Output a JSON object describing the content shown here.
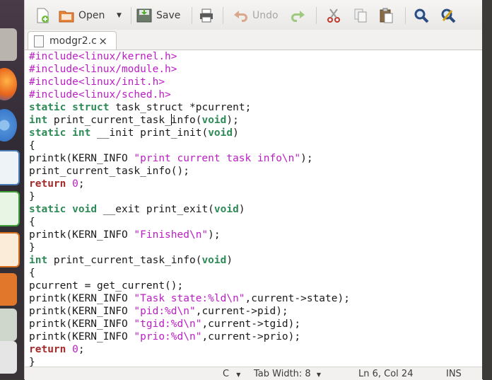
{
  "toolbar": {
    "open_label": "Open",
    "save_label": "Save",
    "undo_label": "Undo"
  },
  "tab": {
    "filename": "modgr2.c",
    "close": "×"
  },
  "code_lines": [
    "#include<linux/kernel.h>",
    "#include<linux/module.h>",
    "#include<linux/init.h>",
    "#include<linux/sched.h>",
    "static struct task_struct *pcurrent;",
    "int print_current_task_info(void);",
    "static int __init print_init(void)",
    "{",
    "printk(KERN_INFO \"print current task info\\n\");",
    "print_current_task_info();",
    "return 0;",
    "}",
    "static void __exit print_exit(void)",
    "{",
    "printk(KERN_INFO \"Finished\\n\");",
    "}",
    "int print_current_task_info(void)",
    "{",
    "pcurrent = get_current();",
    "printk(KERN_INFO \"Task state:%ld\\n\",current->state);",
    "printk(KERN_INFO \"pid:%d\\n\",current->pid);",
    "printk(KERN_INFO \"tgid:%d\\n\",current->tgid);",
    "printk(KERN_INFO \"prio:%d\\n\",current->prio);",
    "return 0;",
    "}"
  ],
  "statusbar": {
    "language": "C",
    "tab_width": "Tab Width: 8",
    "position": "Ln 6, Col 24",
    "mode": "INS"
  },
  "icons": [
    "new-document-icon",
    "open-folder-icon",
    "save-icon",
    "print-icon",
    "undo-icon",
    "redo-icon",
    "cut-icon",
    "copy-icon",
    "paste-icon",
    "search-icon",
    "replace-icon"
  ],
  "colors": {
    "preprocessor": "#bb1ec4",
    "keyword": "#2e8b57",
    "return_keyword": "#a52a2a",
    "string": "#bb1ec4"
  }
}
